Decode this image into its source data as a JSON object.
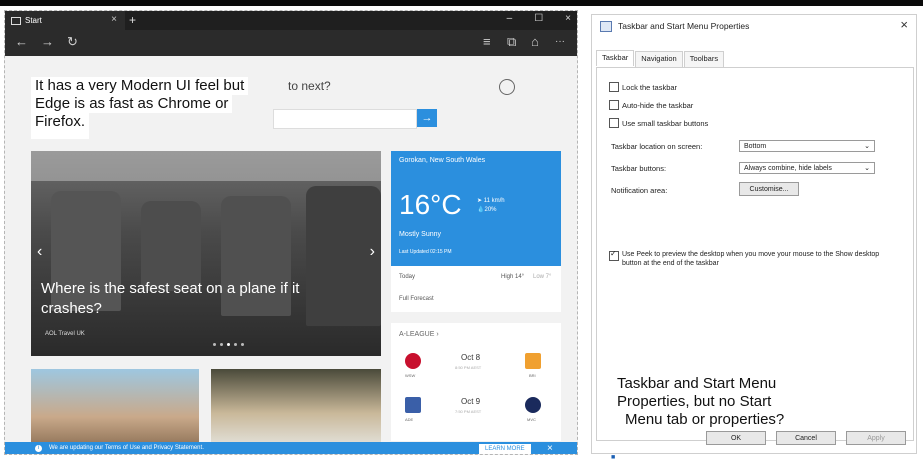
{
  "edge": {
    "tab_title": "Start",
    "tab_close": "×",
    "new_tab": "+",
    "window_controls": [
      "–",
      "☐",
      "×"
    ],
    "nav": {
      "back": "←",
      "forward": "→",
      "refresh": "↻",
      "hub": "≡",
      "note": "⧉",
      "share": "⌂",
      "more": "···"
    },
    "where_next": "to next?",
    "search_go": "→",
    "caption": [
      "It has a very Modern UI feel but",
      "Edge is as fast as Chrome or",
      "Firefox."
    ],
    "hero": {
      "title": "Where is the safest seat on a plane if it crashes?",
      "source": "AOL Travel UK",
      "prev": "‹",
      "next": "›"
    },
    "weather": {
      "location": "Gorokan, New South Wales",
      "temperature": "16°C",
      "wind": "11 km/h",
      "humidity": "20%",
      "condition": "Mostly Sunny",
      "updated": "Last Updated 02:15 PM",
      "today_label": "Today",
      "today_high": "High 14°",
      "today_low": "Low 7°",
      "full_forecast": "Full Forecast"
    },
    "league": {
      "title": "A-LEAGUE",
      "matches": [
        {
          "date": "Oct 8",
          "time": "8:50 PM AEST",
          "home": "WSW",
          "away": "BRI"
        },
        {
          "date": "Oct 9",
          "time": "7:50 PM AEST",
          "home": "ADE",
          "away": "MVC"
        }
      ]
    },
    "notice": {
      "text": "We are updating our Terms of Use and Privacy Statement.",
      "button": "LEARN MORE",
      "close": "×"
    }
  },
  "dialog": {
    "title": "Taskbar and Start Menu Properties",
    "close": "×",
    "tabs": [
      "Taskbar",
      "Navigation",
      "Toolbars"
    ],
    "checkboxes": [
      {
        "label": "Lock the taskbar",
        "checked": false
      },
      {
        "label": "Auto-hide the taskbar",
        "checked": false
      },
      {
        "label": "Use small taskbar buttons",
        "checked": false
      }
    ],
    "location_label": "Taskbar location on screen:",
    "location_value": "Bottom",
    "buttons_label": "Taskbar buttons:",
    "buttons_value": "Always combine, hide labels",
    "notification_label": "Notification area:",
    "customise": "Customise...",
    "peek": "Use Peek to preview the desktop when you move your mouse to the Show desktop button at the end of the taskbar",
    "ok": "OK",
    "cancel": "Cancel",
    "apply": "Apply",
    "caption": [
      "Taskbar and Start Menu",
      "Properties, but no Start",
      "Menu tab or properties?"
    ]
  }
}
